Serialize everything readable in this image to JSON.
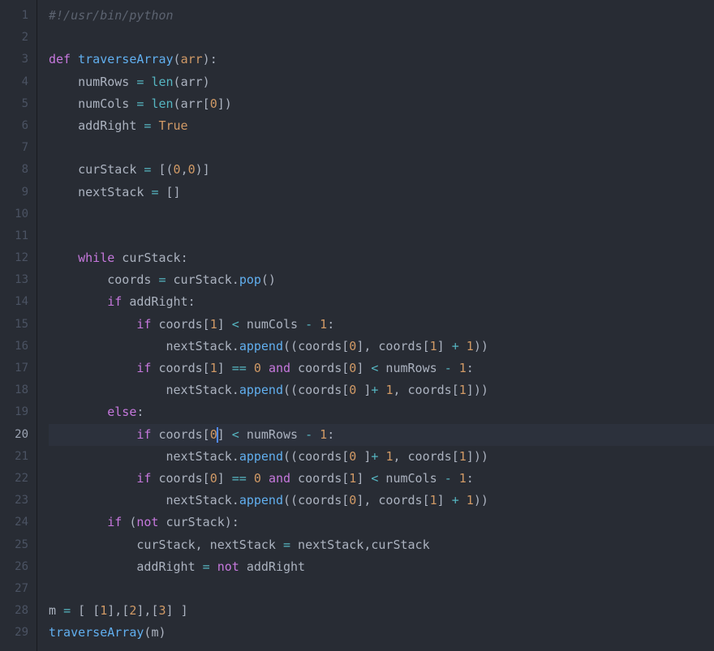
{
  "editor": {
    "activeLine": 20,
    "lineNumbers": [
      "1",
      "2",
      "3",
      "4",
      "5",
      "6",
      "7",
      "8",
      "9",
      "10",
      "11",
      "12",
      "13",
      "14",
      "15",
      "16",
      "17",
      "18",
      "19",
      "20",
      "21",
      "22",
      "23",
      "24",
      "25",
      "26",
      "27",
      "28",
      "29"
    ],
    "lines": [
      [
        {
          "t": "#!/usr/bin/python",
          "c": "comment"
        }
      ],
      [],
      [
        {
          "t": "def ",
          "c": "def"
        },
        {
          "t": "traverseArray",
          "c": "funcname"
        },
        {
          "t": "(",
          "c": "paren"
        },
        {
          "t": "arr",
          "c": "param"
        },
        {
          "t": ")",
          "c": "paren"
        },
        {
          "t": ":",
          "c": "punct"
        }
      ],
      [
        {
          "t": "    numRows ",
          "c": "var"
        },
        {
          "t": "=",
          "c": "op"
        },
        {
          "t": " ",
          "c": "var"
        },
        {
          "t": "len",
          "c": "builtin"
        },
        {
          "t": "(",
          "c": "paren"
        },
        {
          "t": "arr",
          "c": "var"
        },
        {
          "t": ")",
          "c": "paren"
        }
      ],
      [
        {
          "t": "    numCols ",
          "c": "var"
        },
        {
          "t": "=",
          "c": "op"
        },
        {
          "t": " ",
          "c": "var"
        },
        {
          "t": "len",
          "c": "builtin"
        },
        {
          "t": "(",
          "c": "paren"
        },
        {
          "t": "arr",
          "c": "var"
        },
        {
          "t": "[",
          "c": "paren"
        },
        {
          "t": "0",
          "c": "number"
        },
        {
          "t": "]",
          "c": "paren"
        },
        {
          "t": ")",
          "c": "paren"
        }
      ],
      [
        {
          "t": "    addRight ",
          "c": "var"
        },
        {
          "t": "=",
          "c": "op"
        },
        {
          "t": " ",
          "c": "var"
        },
        {
          "t": "True",
          "c": "const"
        }
      ],
      [],
      [
        {
          "t": "    curStack ",
          "c": "var"
        },
        {
          "t": "=",
          "c": "op"
        },
        {
          "t": " ",
          "c": "var"
        },
        {
          "t": "[",
          "c": "paren"
        },
        {
          "t": "(",
          "c": "paren"
        },
        {
          "t": "0",
          "c": "number"
        },
        {
          "t": ",",
          "c": "punct"
        },
        {
          "t": "0",
          "c": "number"
        },
        {
          "t": ")",
          "c": "paren"
        },
        {
          "t": "]",
          "c": "paren"
        }
      ],
      [
        {
          "t": "    nextStack ",
          "c": "var"
        },
        {
          "t": "=",
          "c": "op"
        },
        {
          "t": " ",
          "c": "var"
        },
        {
          "t": "[]",
          "c": "paren"
        }
      ],
      [],
      [],
      [
        {
          "t": "    ",
          "c": "var"
        },
        {
          "t": "while",
          "c": "keyword"
        },
        {
          "t": " curStack",
          "c": "var"
        },
        {
          "t": ":",
          "c": "punct"
        }
      ],
      [
        {
          "t": "        coords ",
          "c": "var"
        },
        {
          "t": "=",
          "c": "op"
        },
        {
          "t": " curStack.",
          "c": "var"
        },
        {
          "t": "pop",
          "c": "funcname"
        },
        {
          "t": "()",
          "c": "paren"
        }
      ],
      [
        {
          "t": "        ",
          "c": "var"
        },
        {
          "t": "if",
          "c": "keyword"
        },
        {
          "t": " addRight",
          "c": "var"
        },
        {
          "t": ":",
          "c": "punct"
        }
      ],
      [
        {
          "t": "            ",
          "c": "var"
        },
        {
          "t": "if",
          "c": "keyword"
        },
        {
          "t": " coords",
          "c": "var"
        },
        {
          "t": "[",
          "c": "paren"
        },
        {
          "t": "1",
          "c": "number"
        },
        {
          "t": "]",
          "c": "paren"
        },
        {
          "t": " ",
          "c": "var"
        },
        {
          "t": "<",
          "c": "op"
        },
        {
          "t": " numCols ",
          "c": "var"
        },
        {
          "t": "-",
          "c": "op"
        },
        {
          "t": " ",
          "c": "var"
        },
        {
          "t": "1",
          "c": "number"
        },
        {
          "t": ":",
          "c": "punct"
        }
      ],
      [
        {
          "t": "                nextStack.",
          "c": "var"
        },
        {
          "t": "append",
          "c": "funcname"
        },
        {
          "t": "((",
          "c": "paren"
        },
        {
          "t": "coords",
          "c": "var"
        },
        {
          "t": "[",
          "c": "paren"
        },
        {
          "t": "0",
          "c": "number"
        },
        {
          "t": "]",
          "c": "paren"
        },
        {
          "t": ", coords",
          "c": "var"
        },
        {
          "t": "[",
          "c": "paren"
        },
        {
          "t": "1",
          "c": "number"
        },
        {
          "t": "]",
          "c": "paren"
        },
        {
          "t": " ",
          "c": "var"
        },
        {
          "t": "+",
          "c": "op"
        },
        {
          "t": " ",
          "c": "var"
        },
        {
          "t": "1",
          "c": "number"
        },
        {
          "t": "))",
          "c": "paren"
        }
      ],
      [
        {
          "t": "            ",
          "c": "var"
        },
        {
          "t": "if",
          "c": "keyword"
        },
        {
          "t": " coords",
          "c": "var"
        },
        {
          "t": "[",
          "c": "paren"
        },
        {
          "t": "1",
          "c": "number"
        },
        {
          "t": "]",
          "c": "paren"
        },
        {
          "t": " ",
          "c": "var"
        },
        {
          "t": "==",
          "c": "op"
        },
        {
          "t": " ",
          "c": "var"
        },
        {
          "t": "0",
          "c": "number"
        },
        {
          "t": " ",
          "c": "var"
        },
        {
          "t": "and",
          "c": "keyword"
        },
        {
          "t": " coords",
          "c": "var"
        },
        {
          "t": "[",
          "c": "paren"
        },
        {
          "t": "0",
          "c": "number"
        },
        {
          "t": "]",
          "c": "paren"
        },
        {
          "t": " ",
          "c": "var"
        },
        {
          "t": "<",
          "c": "op"
        },
        {
          "t": " numRows ",
          "c": "var"
        },
        {
          "t": "-",
          "c": "op"
        },
        {
          "t": " ",
          "c": "var"
        },
        {
          "t": "1",
          "c": "number"
        },
        {
          "t": ":",
          "c": "punct"
        }
      ],
      [
        {
          "t": "                nextStack.",
          "c": "var"
        },
        {
          "t": "append",
          "c": "funcname"
        },
        {
          "t": "((",
          "c": "paren"
        },
        {
          "t": "coords",
          "c": "var"
        },
        {
          "t": "[",
          "c": "paren"
        },
        {
          "t": "0",
          "c": "number"
        },
        {
          "t": " ",
          "c": "var"
        },
        {
          "t": "]",
          "c": "paren"
        },
        {
          "t": "+",
          "c": "op"
        },
        {
          "t": " ",
          "c": "var"
        },
        {
          "t": "1",
          "c": "number"
        },
        {
          "t": ", coords",
          "c": "var"
        },
        {
          "t": "[",
          "c": "paren"
        },
        {
          "t": "1",
          "c": "number"
        },
        {
          "t": "]",
          "c": "paren"
        },
        {
          "t": "))",
          "c": "paren"
        }
      ],
      [
        {
          "t": "        ",
          "c": "var"
        },
        {
          "t": "else",
          "c": "keyword"
        },
        {
          "t": ":",
          "c": "punct"
        }
      ],
      [
        {
          "t": "            ",
          "c": "var"
        },
        {
          "t": "if",
          "c": "keyword"
        },
        {
          "t": " coords",
          "c": "var"
        },
        {
          "t": "[",
          "c": "paren"
        },
        {
          "t": "0",
          "c": "number",
          "cursor": true
        },
        {
          "t": "]",
          "c": "paren"
        },
        {
          "t": " ",
          "c": "var"
        },
        {
          "t": "<",
          "c": "op"
        },
        {
          "t": " numRows ",
          "c": "var"
        },
        {
          "t": "-",
          "c": "op"
        },
        {
          "t": " ",
          "c": "var"
        },
        {
          "t": "1",
          "c": "number"
        },
        {
          "t": ":",
          "c": "punct"
        }
      ],
      [
        {
          "t": "                nextStack.",
          "c": "var"
        },
        {
          "t": "append",
          "c": "funcname"
        },
        {
          "t": "((",
          "c": "paren"
        },
        {
          "t": "coords",
          "c": "var"
        },
        {
          "t": "[",
          "c": "paren"
        },
        {
          "t": "0",
          "c": "number"
        },
        {
          "t": " ",
          "c": "var"
        },
        {
          "t": "]",
          "c": "paren"
        },
        {
          "t": "+",
          "c": "op"
        },
        {
          "t": " ",
          "c": "var"
        },
        {
          "t": "1",
          "c": "number"
        },
        {
          "t": ", coords",
          "c": "var"
        },
        {
          "t": "[",
          "c": "paren"
        },
        {
          "t": "1",
          "c": "number"
        },
        {
          "t": "]",
          "c": "paren"
        },
        {
          "t": "))",
          "c": "paren"
        }
      ],
      [
        {
          "t": "            ",
          "c": "var"
        },
        {
          "t": "if",
          "c": "keyword"
        },
        {
          "t": " coords",
          "c": "var"
        },
        {
          "t": "[",
          "c": "paren"
        },
        {
          "t": "0",
          "c": "number"
        },
        {
          "t": "]",
          "c": "paren"
        },
        {
          "t": " ",
          "c": "var"
        },
        {
          "t": "==",
          "c": "op"
        },
        {
          "t": " ",
          "c": "var"
        },
        {
          "t": "0",
          "c": "number"
        },
        {
          "t": " ",
          "c": "var"
        },
        {
          "t": "and",
          "c": "keyword"
        },
        {
          "t": " coords",
          "c": "var"
        },
        {
          "t": "[",
          "c": "paren"
        },
        {
          "t": "1",
          "c": "number"
        },
        {
          "t": "]",
          "c": "paren"
        },
        {
          "t": " ",
          "c": "var"
        },
        {
          "t": "<",
          "c": "op"
        },
        {
          "t": " numCols ",
          "c": "var"
        },
        {
          "t": "-",
          "c": "op"
        },
        {
          "t": " ",
          "c": "var"
        },
        {
          "t": "1",
          "c": "number"
        },
        {
          "t": ":",
          "c": "punct"
        }
      ],
      [
        {
          "t": "                nextStack.",
          "c": "var"
        },
        {
          "t": "append",
          "c": "funcname"
        },
        {
          "t": "((",
          "c": "paren"
        },
        {
          "t": "coords",
          "c": "var"
        },
        {
          "t": "[",
          "c": "paren"
        },
        {
          "t": "0",
          "c": "number"
        },
        {
          "t": "]",
          "c": "paren"
        },
        {
          "t": ", coords",
          "c": "var"
        },
        {
          "t": "[",
          "c": "paren"
        },
        {
          "t": "1",
          "c": "number"
        },
        {
          "t": "]",
          "c": "paren"
        },
        {
          "t": " ",
          "c": "var"
        },
        {
          "t": "+",
          "c": "op"
        },
        {
          "t": " ",
          "c": "var"
        },
        {
          "t": "1",
          "c": "number"
        },
        {
          "t": "))",
          "c": "paren"
        }
      ],
      [
        {
          "t": "        ",
          "c": "var"
        },
        {
          "t": "if",
          "c": "keyword"
        },
        {
          "t": " ",
          "c": "var"
        },
        {
          "t": "(",
          "c": "paren"
        },
        {
          "t": "not",
          "c": "keyword"
        },
        {
          "t": " curStack",
          "c": "var"
        },
        {
          "t": ")",
          "c": "paren"
        },
        {
          "t": ":",
          "c": "punct"
        }
      ],
      [
        {
          "t": "            curStack, nextStack ",
          "c": "var"
        },
        {
          "t": "=",
          "c": "op"
        },
        {
          "t": " nextStack,curStack",
          "c": "var"
        }
      ],
      [
        {
          "t": "            addRight ",
          "c": "var"
        },
        {
          "t": "=",
          "c": "op"
        },
        {
          "t": " ",
          "c": "var"
        },
        {
          "t": "not",
          "c": "keyword"
        },
        {
          "t": " addRight",
          "c": "var"
        }
      ],
      [],
      [
        {
          "t": "m ",
          "c": "var"
        },
        {
          "t": "=",
          "c": "op"
        },
        {
          "t": " ",
          "c": "var"
        },
        {
          "t": "[",
          "c": "paren"
        },
        {
          "t": " ",
          "c": "var"
        },
        {
          "t": "[",
          "c": "paren"
        },
        {
          "t": "1",
          "c": "number"
        },
        {
          "t": "]",
          "c": "paren"
        },
        {
          "t": ",",
          "c": "punct"
        },
        {
          "t": "[",
          "c": "paren"
        },
        {
          "t": "2",
          "c": "number"
        },
        {
          "t": "]",
          "c": "paren"
        },
        {
          "t": ",",
          "c": "punct"
        },
        {
          "t": "[",
          "c": "paren"
        },
        {
          "t": "3",
          "c": "number"
        },
        {
          "t": "]",
          "c": "paren"
        },
        {
          "t": " ",
          "c": "var"
        },
        {
          "t": "]",
          "c": "paren"
        }
      ],
      [
        {
          "t": "traverseArray",
          "c": "funcname"
        },
        {
          "t": "(",
          "c": "paren"
        },
        {
          "t": "m",
          "c": "var"
        },
        {
          "t": ")",
          "c": "paren"
        }
      ]
    ]
  }
}
